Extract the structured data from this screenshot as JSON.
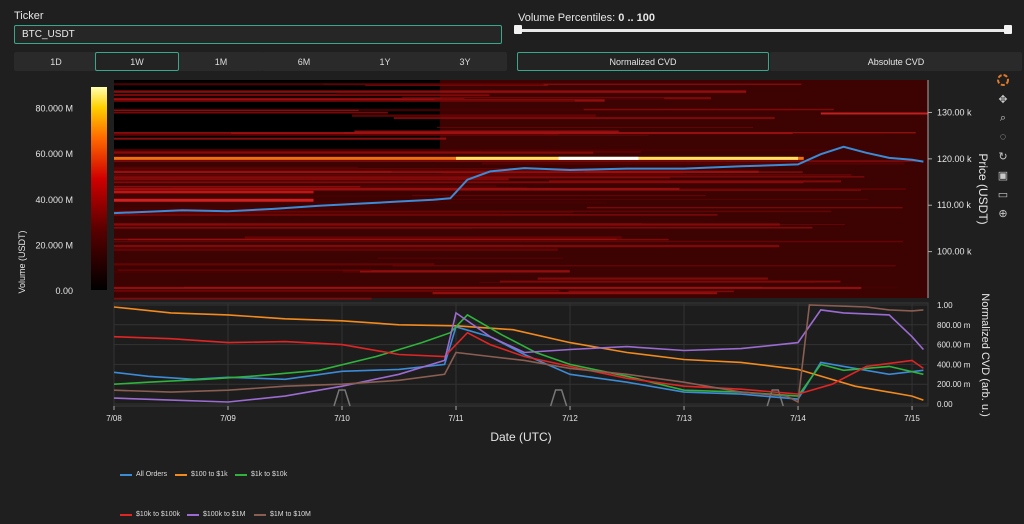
{
  "ticker": {
    "label": "Ticker",
    "value": "BTC_USDT"
  },
  "percentiles": {
    "label": "Volume Percentiles:",
    "value": "0 .. 100",
    "low": 0,
    "high": 100
  },
  "timeframes": [
    "1D",
    "1W",
    "1M",
    "6M",
    "1Y",
    "3Y"
  ],
  "active_timeframe": "1W",
  "modes": [
    "Normalized CVD",
    "Absolute CVD"
  ],
  "active_mode": "Normalized CVD",
  "toolbar_icons": [
    "plotly-logo-icon",
    "pan-icon",
    "zoom-icon",
    "lasso-icon",
    "reset-icon",
    "download-icon",
    "comment-icon",
    "target-icon"
  ],
  "colors": {
    "accent": "#3aa68a",
    "price_line": "#3b8bd6"
  },
  "chart_data": [
    {
      "type": "heatmap",
      "title": "",
      "xlabel": "",
      "ylabel": "Price (USDT)",
      "colorbar_label": "Volume (USDT)",
      "colorbar_ticks": [
        "0.00",
        "20.000 M",
        "40.000 M",
        "60.000 M",
        "80.000 M"
      ],
      "ylim": [
        90000,
        137000
      ],
      "y_ticks": [
        100000,
        110000,
        120000,
        130000
      ],
      "y_tick_labels": [
        "100.00 k",
        "110.00 k",
        "120.00 k",
        "130.00 k"
      ],
      "x_ticks": [
        "7/08",
        "7/09",
        "7/10",
        "7/11",
        "7/12",
        "7/13",
        "7/14",
        "7/15"
      ],
      "price_series": {
        "name": "Price",
        "x": [
          0,
          0.3,
          0.6,
          1.0,
          1.4,
          1.8,
          2.2,
          2.5,
          2.8,
          2.95,
          3.1,
          3.3,
          3.6,
          4.0,
          4.5,
          5.0,
          5.5,
          6.0,
          6.2,
          6.4,
          6.6,
          6.8,
          7.0,
          7.1
        ],
        "y": [
          108300,
          108600,
          108900,
          108700,
          109200,
          109900,
          110400,
          110800,
          111200,
          111500,
          115500,
          117300,
          118000,
          117600,
          117900,
          117900,
          118400,
          118800,
          121000,
          122600,
          121300,
          120200,
          119800,
          119400
        ]
      }
    },
    {
      "type": "line",
      "title": "",
      "xlabel": "Date (UTC)",
      "ylabel": "Normalized CVD (arb. u.)",
      "ylim": [
        -0.02,
        1.02
      ],
      "y_ticks": [
        0,
        0.2,
        0.4,
        0.6,
        0.8,
        1.0
      ],
      "y_tick_labels": [
        "0.00",
        "200.00 m",
        "400.00 m",
        "600.00 m",
        "800.00 m",
        "1.00"
      ],
      "x_ticks": [
        "7/08",
        "7/09",
        "7/10",
        "7/11",
        "7/12",
        "7/13",
        "7/14",
        "7/15"
      ],
      "series": [
        {
          "name": "All Orders",
          "color": "#3b8bd6",
          "x": [
            0,
            0.3,
            0.7,
            1.0,
            1.5,
            2.0,
            2.5,
            2.9,
            3.0,
            3.3,
            3.6,
            4.0,
            4.5,
            5.0,
            5.5,
            6.0,
            6.2,
            6.4,
            6.8,
            7.1
          ],
          "y": [
            0.32,
            0.28,
            0.25,
            0.27,
            0.25,
            0.33,
            0.35,
            0.4,
            0.78,
            0.68,
            0.5,
            0.3,
            0.22,
            0.12,
            0.1,
            0.05,
            0.42,
            0.38,
            0.3,
            0.34
          ]
        },
        {
          "name": "$100 to $1k",
          "color": "#f28a1e",
          "x": [
            0,
            0.5,
            1.0,
            1.5,
            2.0,
            2.5,
            3.0,
            3.5,
            4.0,
            4.5,
            5.0,
            5.5,
            6.0,
            6.5,
            7.0,
            7.1
          ],
          "y": [
            0.98,
            0.92,
            0.9,
            0.86,
            0.84,
            0.8,
            0.79,
            0.75,
            0.62,
            0.52,
            0.45,
            0.42,
            0.35,
            0.18,
            0.08,
            0.04
          ]
        },
        {
          "name": "$1k to $10k",
          "color": "#2fb33c",
          "x": [
            0,
            0.3,
            0.8,
            1.2,
            1.8,
            2.3,
            2.7,
            2.95,
            3.1,
            3.4,
            3.7,
            4.0,
            4.5,
            5.0,
            5.5,
            6.0,
            6.2,
            6.4,
            6.8,
            7.1
          ],
          "y": [
            0.2,
            0.22,
            0.25,
            0.28,
            0.34,
            0.48,
            0.62,
            0.72,
            0.9,
            0.7,
            0.52,
            0.4,
            0.28,
            0.14,
            0.12,
            0.08,
            0.4,
            0.34,
            0.38,
            0.3
          ]
        },
        {
          "name": "$10k to $100k",
          "color": "#e02525",
          "x": [
            0,
            0.5,
            1.0,
            1.5,
            2.0,
            2.5,
            2.9,
            3.1,
            3.3,
            3.6,
            4.0,
            4.5,
            5.0,
            5.5,
            6.0,
            6.3,
            6.6,
            7.0,
            7.1
          ],
          "y": [
            0.68,
            0.66,
            0.62,
            0.63,
            0.6,
            0.5,
            0.48,
            0.72,
            0.6,
            0.48,
            0.38,
            0.26,
            0.18,
            0.15,
            0.1,
            0.2,
            0.38,
            0.44,
            0.36
          ]
        },
        {
          "name": "$100k to $1M",
          "color": "#9b6bd1",
          "x": [
            0,
            0.5,
            1.0,
            1.5,
            2.0,
            2.5,
            2.9,
            3.0,
            3.3,
            3.6,
            4.0,
            4.5,
            5.0,
            5.5,
            6.0,
            6.2,
            6.4,
            6.8,
            7.0,
            7.1
          ],
          "y": [
            0.06,
            0.04,
            0.02,
            0.08,
            0.18,
            0.3,
            0.44,
            0.92,
            0.68,
            0.52,
            0.55,
            0.58,
            0.54,
            0.56,
            0.62,
            0.95,
            0.92,
            0.9,
            0.68,
            0.55
          ]
        },
        {
          "name": "$1M to $10M",
          "color": "#8a5e52",
          "x": [
            0,
            0.5,
            1.0,
            1.5,
            2.0,
            2.5,
            2.9,
            3.0,
            3.3,
            3.6,
            4.0,
            4.5,
            5.0,
            5.5,
            5.9,
            6.0,
            6.1,
            6.6,
            6.8,
            7.0,
            7.1
          ],
          "y": [
            0.14,
            0.12,
            0.14,
            0.18,
            0.2,
            0.24,
            0.3,
            0.52,
            0.48,
            0.44,
            0.36,
            0.3,
            0.22,
            0.12,
            0.08,
            0.02,
            1.0,
            0.98,
            0.95,
            0.94,
            0.95
          ]
        }
      ]
    }
  ]
}
